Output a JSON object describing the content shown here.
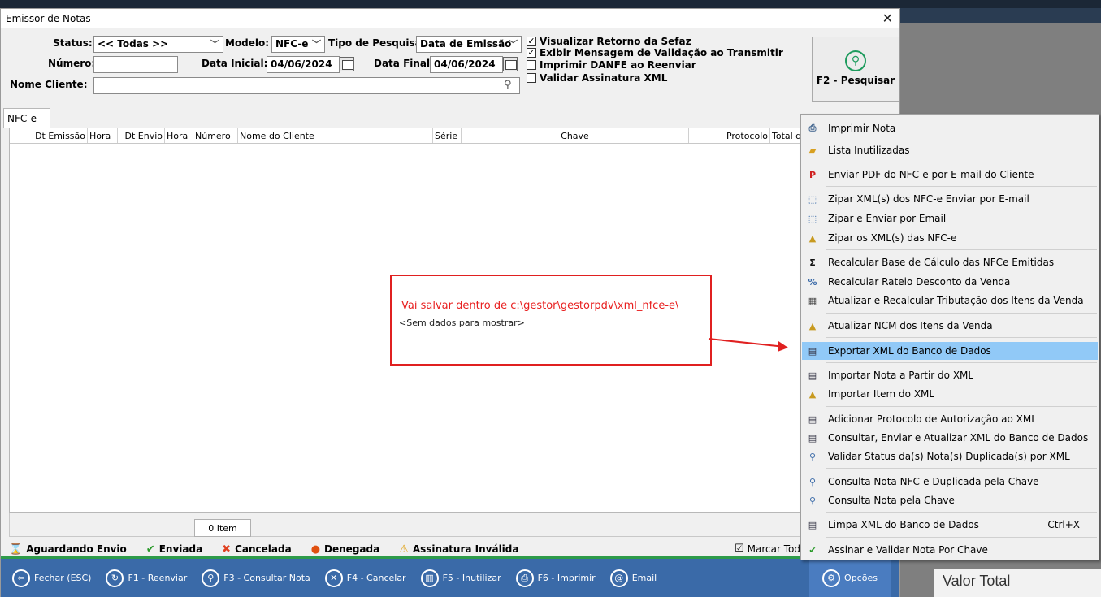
{
  "window": {
    "title": "Emissor de Notas",
    "close": "✕"
  },
  "filters": {
    "status_label": "Status:",
    "status_value": "<< Todas >>",
    "modelo_label": "Modelo:",
    "modelo_value": "NFC-e",
    "tipo_label": "Tipo de Pesquisa:",
    "tipo_value": "Data de Emissão",
    "numero_label": "Número:",
    "numero_value": "",
    "data_inicial_label": "Data Inicial:",
    "data_inicial_value": "04/06/2024",
    "data_final_label": "Data Final:",
    "data_final_value": "04/06/2024",
    "nome_cliente_label": "Nome Cliente:",
    "nome_cliente_value": ""
  },
  "checkboxes": [
    {
      "label": "Visualizar Retorno da Sefaz",
      "checked": true
    },
    {
      "label": "Exibir Mensagem de Validação ao Transmitir",
      "checked": true
    },
    {
      "label": "Imprimir DANFE ao Reenviar",
      "checked": false
    },
    {
      "label": "Validar Assinatura XML",
      "checked": false
    }
  ],
  "search_button": "F2 - Pesquisar",
  "tab": "NFC-e",
  "columns": [
    "Dt Emissão",
    "Hora",
    "Dt Envio",
    "Hora",
    "Número",
    "Nome do Cliente",
    "Série",
    "Chave",
    "Protocolo",
    "Total d"
  ],
  "annotation": {
    "message": "Vai salvar dentro de c:\\gestor\\gestorpdv\\xml_nfce-e\\",
    "no_data": "<Sem dados para mostrar>"
  },
  "footer": {
    "item_count": "0 Item"
  },
  "legend": {
    "aguardando": "Aguardando Envio",
    "enviada": "Enviada",
    "cancelada": "Cancelada",
    "denegada": "Denegada",
    "assinatura": "Assinatura Inválida",
    "marcar": "Marcar Todo"
  },
  "toolbar": {
    "fechar": "Fechar (ESC)",
    "reenviar": "F1 - Reenviar",
    "consultar": "F3 - Consultar Nota",
    "cancelar": "F4 - Cancelar",
    "inutilizar": "F5 - Inutilizar",
    "imprimir": "F6 - Imprimir",
    "email": "Email",
    "opcoes": "Opções"
  },
  "background": {
    "valor_total": "Valor Total"
  },
  "menu": [
    {
      "label": "Imprimir Nota",
      "icon": "printer-icon"
    },
    {
      "label": "Lista Inutilizadas",
      "icon": "folder-icon"
    },
    {
      "label": "Enviar PDF do NFC-e por E-mail do Cliente",
      "icon": "pdf-icon"
    },
    {
      "label": "Zipar XML(s) dos NFC-e Enviar por E-mail",
      "icon": "zip-icon"
    },
    {
      "label": "Zipar e Enviar por Email",
      "icon": "zip-icon"
    },
    {
      "label": "Zipar os XML(s) das NFC-e",
      "icon": "folder-up-icon"
    },
    {
      "label": "Recalcular Base de Cálculo das NFCe Emitidas",
      "icon": "sigma-icon"
    },
    {
      "label": "Recalcular Rateio Desconto da Venda",
      "icon": "percent-icon"
    },
    {
      "label": "Atualizar e Recalcular Tributação dos Itens da Venda",
      "icon": "calc-icon"
    },
    {
      "label": "Atualizar NCM dos Itens da Venda",
      "icon": "folder-up-icon"
    },
    {
      "label": "Exportar XML do Banco de Dados",
      "icon": "xml-icon"
    },
    {
      "label": "Importar Nota a Partir do XML",
      "icon": "xml-icon"
    },
    {
      "label": "Importar Item do XML",
      "icon": "folder-up-icon"
    },
    {
      "label": "Adicionar Protocolo de Autorização ao XML",
      "icon": "xml-icon"
    },
    {
      "label": "Consultar, Enviar e Atualizar XML do Banco de Dados",
      "icon": "xml-icon"
    },
    {
      "label": "Validar Status da(s) Nota(s) Duplicada(s) por XML",
      "icon": "search-doc-icon"
    },
    {
      "label": "Consulta Nota NFC-e Duplicada pela Chave",
      "icon": "search-doc-icon"
    },
    {
      "label": "Consulta Nota pela Chave",
      "icon": "search-doc-icon"
    },
    {
      "label": "Limpa XML do Banco de Dados",
      "icon": "xml-icon",
      "shortcut": "Ctrl+X"
    },
    {
      "label": "Assinar e Validar Nota Por Chave",
      "icon": "check-icon"
    }
  ],
  "colors": {
    "accent": "#3a6aa8",
    "annotation": "#e02020",
    "selection": "#91c9f7"
  }
}
